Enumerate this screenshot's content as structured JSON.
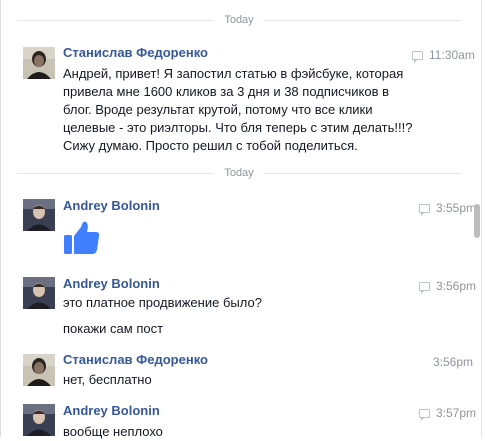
{
  "dividers": [
    "Today",
    "Today"
  ],
  "messages": [
    {
      "sender": "Станислав Федоренко",
      "time": "11:30am",
      "text": "Андрей, привет! Я запостил статью в фэйсбуке, которая привела мне 1600 кликов за 3 дня и 38 подписчиков в блог. Вроде результат крутой, потому что все клики целевые - это риэлторы. Что бля теперь с этим делать!!!? Сижу думаю. Просто решил с тобой поделиться."
    },
    {
      "sender": "Andrey Bolonin",
      "time": "3:55pm",
      "sticker": "thumbs-up"
    },
    {
      "sender": "Andrey Bolonin",
      "time": "3:56pm",
      "lines": [
        "это платное продвижение было?",
        "покажи сам пост"
      ]
    },
    {
      "sender": "Станислав Федоренко",
      "time": "3:56pm",
      "text": "нет, бесплатно"
    },
    {
      "sender": "Andrey Bolonin",
      "time": "3:57pm",
      "text": "вообще неплохо"
    }
  ],
  "colors": {
    "name": "#365899",
    "meta": "#90949c",
    "like": "#4080ff"
  }
}
